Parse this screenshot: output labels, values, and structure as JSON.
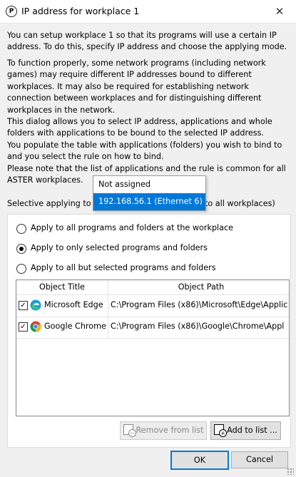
{
  "window": {
    "title": "IP address for workplace 1",
    "title_icon_glyph": "P",
    "close_glyph": "✕"
  },
  "intro": {
    "paragraph1": "You can setup workplace 1 so that its programs will use a certain IP address. To do this, specify IP address and choose the applying mode.",
    "paragraph2": "To function properly, some network programs (including network games) may require different IP addresses bound to different workplaces. It may also be required for establishing network connection between workplaces and for distinguishing different workplaces in the network.\nThis dialog allows you to select IP address, applications and whole folders with applications to be bound to the selected IP address.\nYou populate the table with applications (folders) you wish to bind to and you select the rule on how to bind.\nPlease note that the list of applications and the rule is common for all ASTER workplaces."
  },
  "ip_dropdown": {
    "options": [
      "Not assigned",
      "192.168.56.1 (Ethernet 6)"
    ],
    "highlighted_index": 1
  },
  "selective": {
    "label_visible_part": "Selective applying to sp",
    "label_suffix_visible": "to all workplaces)"
  },
  "radios": [
    {
      "label": "Apply to all programs and folders at the workplace",
      "checked": false
    },
    {
      "label": "Apply to only selected programs and folders",
      "checked": true
    },
    {
      "label": "Apply to all but selected programs and folders",
      "checked": false
    }
  ],
  "table": {
    "columns": [
      "Object Title",
      "Object Path"
    ],
    "rows": [
      {
        "checked": true,
        "icon": "edge-icon",
        "title": "Microsoft Edge",
        "path": "C:\\Program Files (x86)\\Microsoft\\Edge\\Applic"
      },
      {
        "checked": true,
        "icon": "chrome-icon",
        "title": "Google Chrome",
        "path": "C:\\Program Files (x86)\\Google\\Chrome\\Appl"
      }
    ]
  },
  "buttons": {
    "remove": "Remove from list",
    "add": "Add to list ...",
    "ok": "OK",
    "cancel": "Cancel"
  },
  "colors": {
    "accent": "#0078d7",
    "window_bg": "#f0f0f0"
  }
}
